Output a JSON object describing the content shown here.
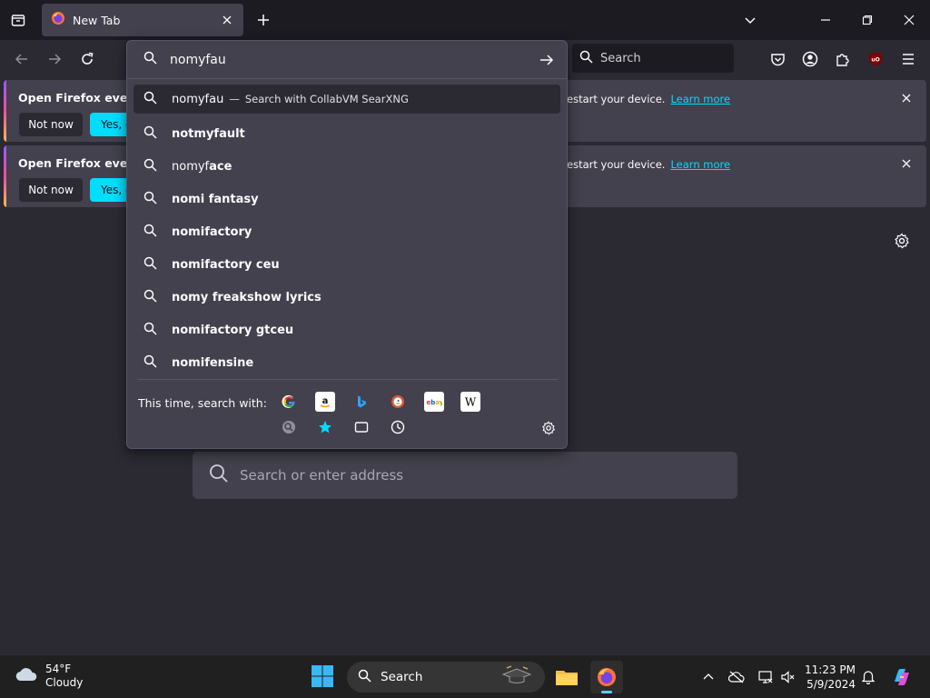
{
  "tab": {
    "title": "New Tab"
  },
  "toolbar": {
    "search_placeholder": "Search"
  },
  "urlbar": {
    "value": "nomyfau",
    "first_result": {
      "query": "nomyfau",
      "separator": "—",
      "action": "Search with CollabVM SearXNG"
    },
    "suggestions": [
      {
        "prefix": "",
        "bold": "notmyfault"
      },
      {
        "prefix": "nomyf",
        "bold": "ace"
      },
      {
        "prefix": "",
        "bold": "nomi fantasy"
      },
      {
        "prefix": "",
        "bold": "nomifactory"
      },
      {
        "prefix": "",
        "bold": "nomifactory ceu"
      },
      {
        "prefix": "",
        "bold": "nomy freakshow lyrics"
      },
      {
        "prefix": "",
        "bold": "nomifactory gtceu"
      },
      {
        "prefix": "",
        "bold": "nomifensine"
      }
    ],
    "engines_label": "This time, search with:"
  },
  "notifications": [
    {
      "title": "Open Firefox every ti",
      "tail": "estart your device.",
      "link": "Learn more",
      "no": "Not now",
      "yes": "Yes, c"
    },
    {
      "title": "Open Firefox every ti",
      "tail": "estart your device.",
      "link": "Learn more",
      "no": "Not now",
      "yes": "Yes, c"
    }
  ],
  "page": {
    "search_placeholder": "Search or enter address"
  },
  "taskbar": {
    "weather_temp": "54°F",
    "weather_desc": "Cloudy",
    "search_label": "Search",
    "time": "11:23 PM",
    "date": "5/9/2024"
  },
  "colors": {
    "accent": "#00ddff",
    "bg": "#2b2a33",
    "panel": "#42414d",
    "chrome": "#1c1b22"
  }
}
